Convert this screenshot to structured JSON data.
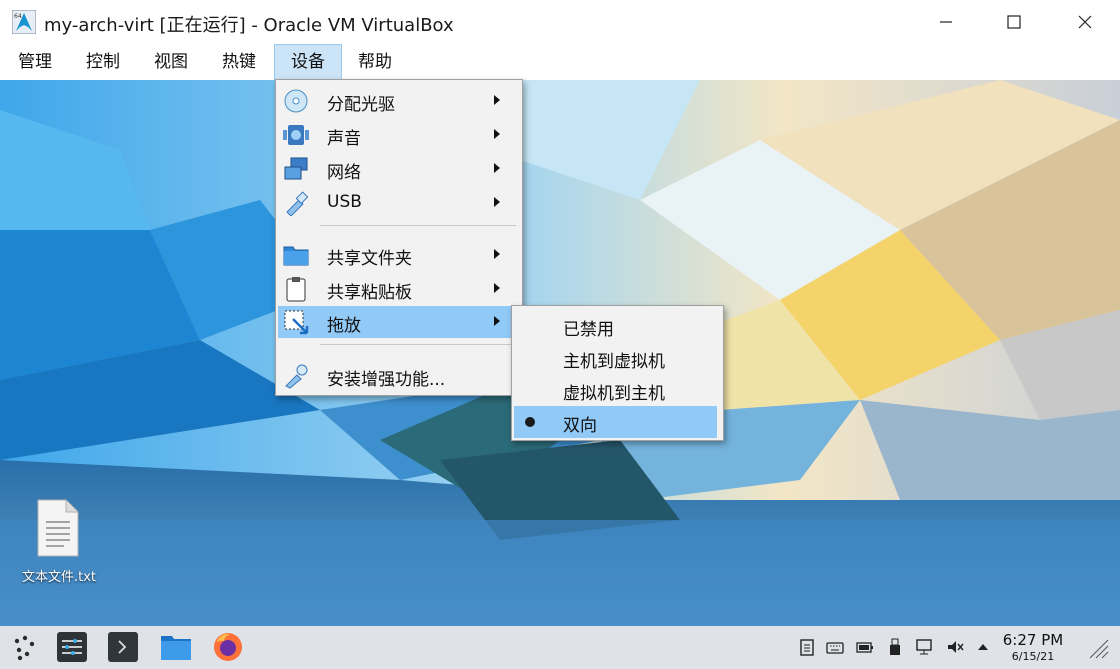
{
  "window": {
    "title": "my-arch-virt [正在运行] - Oracle VM VirtualBox"
  },
  "menubar": {
    "items": [
      "管理",
      "控制",
      "视图",
      "热键",
      "设备",
      "帮助"
    ]
  },
  "devices_menu": {
    "items": [
      {
        "label": "分配光驱",
        "icon": "optical-disc-icon",
        "submenu": true
      },
      {
        "label": "声音",
        "icon": "audio-icon",
        "submenu": true
      },
      {
        "label": "网络",
        "icon": "network-icon",
        "submenu": true
      },
      {
        "label": "USB",
        "icon": "usb-icon",
        "submenu": true
      },
      {
        "label": "共享文件夹",
        "icon": "shared-folder-icon",
        "submenu": true
      },
      {
        "label": "共享粘贴板",
        "icon": "clipboard-icon",
        "submenu": true
      },
      {
        "label": "拖放",
        "icon": "drag-drop-icon",
        "submenu": true
      },
      {
        "label": "安装增强功能...",
        "icon": "guest-additions-icon",
        "submenu": false
      }
    ]
  },
  "drag_drop_submenu": {
    "items": [
      {
        "label": "已禁用",
        "selected": false
      },
      {
        "label": "主机到虚拟机",
        "selected": false
      },
      {
        "label": "虚拟机到主机",
        "selected": false
      },
      {
        "label": "双向",
        "selected": true
      }
    ]
  },
  "desktop": {
    "file_icon_label": "文本文件.txt"
  },
  "taskbar": {
    "time": "6:27 PM",
    "date": "6/15/21"
  }
}
